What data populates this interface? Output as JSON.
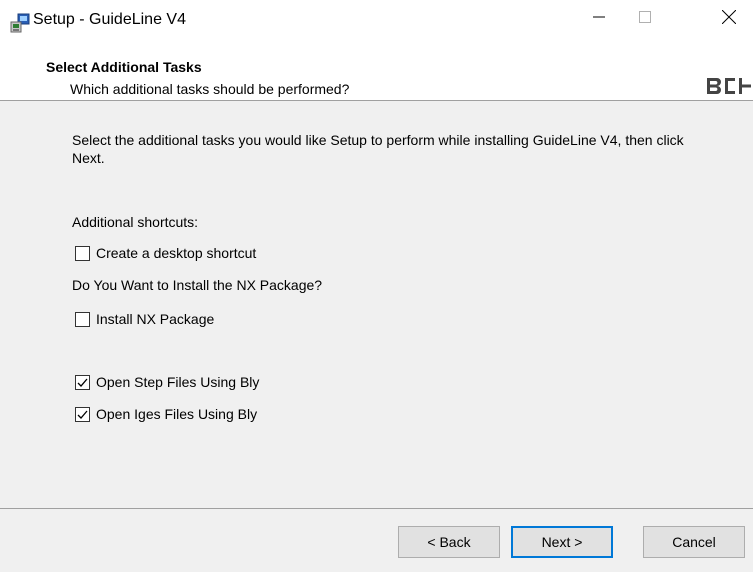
{
  "window": {
    "title": "Setup - GuideLine V4"
  },
  "header": {
    "title": "Select Additional Tasks",
    "subtitle": "Which additional tasks should be performed?"
  },
  "content": {
    "description": "Select the additional tasks you would like Setup to perform while installing GuideLine V4, then click Next.",
    "section_shortcuts": "Additional shortcuts:",
    "section_nx": "Do You Want to Install the NX Package?",
    "checkboxes": [
      {
        "label": "Create a desktop shortcut",
        "checked": false
      },
      {
        "label": "Install NX Package",
        "checked": false
      },
      {
        "label": "Open Step Files Using Bly",
        "checked": true
      },
      {
        "label": "Open Iges Files Using Bly",
        "checked": true
      }
    ]
  },
  "footer": {
    "back_label": "< Back",
    "next_label": "Next >",
    "cancel_label": "Cancel"
  },
  "colors": {
    "accent": "#0078d7",
    "panel": "#f0f0f0",
    "header_bg": "#ffffff"
  }
}
